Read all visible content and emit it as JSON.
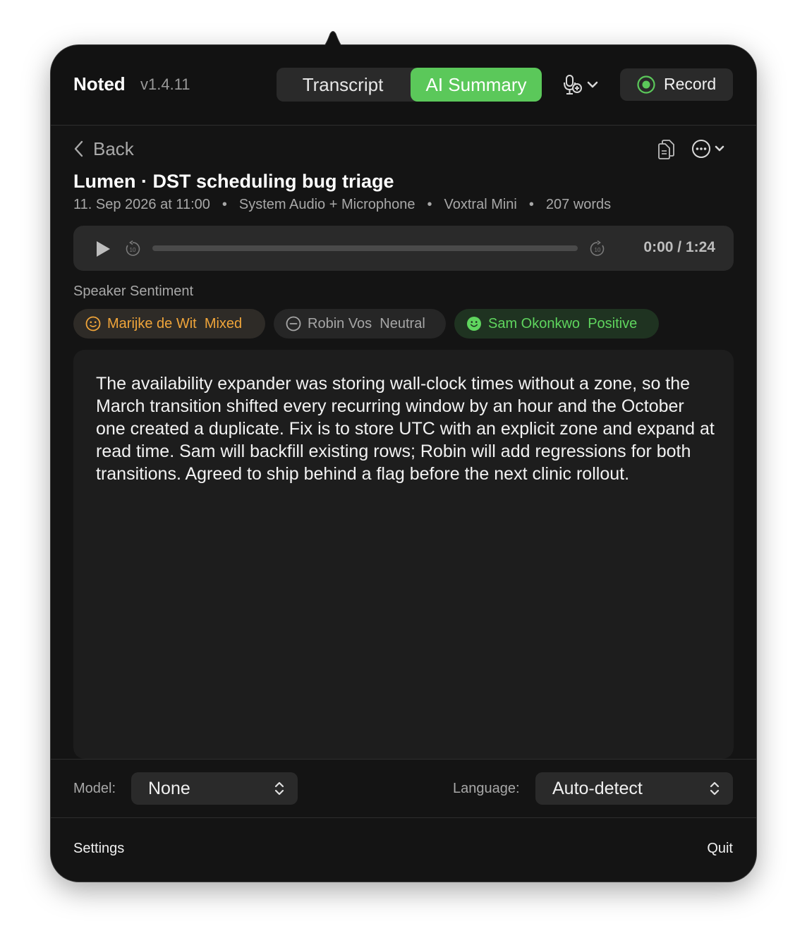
{
  "app": {
    "name": "Noted",
    "version": "v1.4.11"
  },
  "tabs": {
    "transcript": "Transcript",
    "ai_summary": "AI Summary",
    "active": "ai_summary"
  },
  "toolbar": {
    "mic_icon": "microphone-add-icon",
    "record_label": "Record"
  },
  "nav": {
    "back_label": "Back"
  },
  "recording": {
    "title": "Lumen · DST scheduling bug triage",
    "date": "11. Sep 2026 at 11:00",
    "source": "System Audio + Microphone",
    "model": "Voxtral Mini",
    "word_count": "207 words"
  },
  "player": {
    "time": "0:00 / 1:24",
    "progress": 0
  },
  "sentiment": {
    "label": "Speaker Sentiment",
    "speakers": [
      {
        "name": "Marijke de Wit",
        "sentiment": "Mixed",
        "color": "#f0a53a"
      },
      {
        "name": "Robin Vos",
        "sentiment": "Neutral",
        "color": "#a6a6a6"
      },
      {
        "name": "Sam Okonkwo",
        "sentiment": "Positive",
        "color": "#5fd55e"
      }
    ]
  },
  "summary": {
    "text": "The availability expander was storing wall-clock times without a zone, so the March transition shifted every recurring window by an hour and the October one created a duplicate. Fix is to store UTC with an explicit zone and expand at read time. Sam will backfill existing rows; Robin will add regressions for both transitions. Agreed to ship behind a flag before the next clinic rollout."
  },
  "controls": {
    "model_label": "Model:",
    "model_value": "None",
    "language_label": "Language:",
    "language_value": "Auto-detect"
  },
  "footer": {
    "settings": "Settings",
    "quit": "Quit"
  },
  "colors": {
    "accent": "#5bc85a",
    "background": "#141414"
  }
}
